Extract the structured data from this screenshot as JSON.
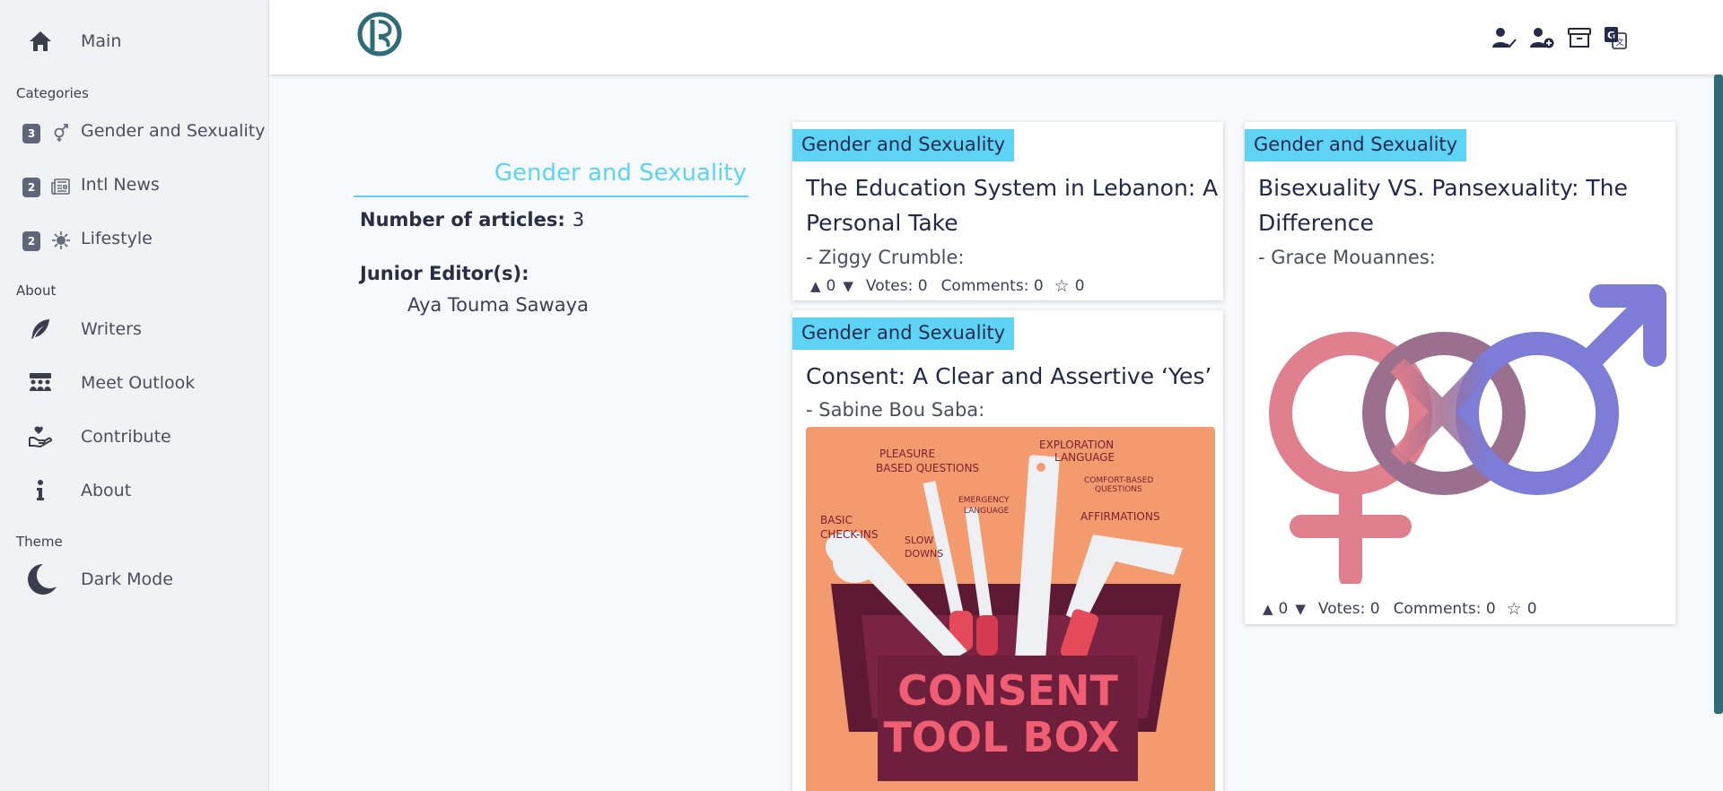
{
  "sidebar": {
    "main_label": "Main",
    "categories_heading": "Categories",
    "categories": [
      {
        "count": "3",
        "label": "Gender and Sexuality",
        "icon": "gender-icon"
      },
      {
        "count": "2",
        "label": "Intl News",
        "icon": "newspaper-icon"
      },
      {
        "count": "2",
        "label": "Lifestyle",
        "icon": "virus-icon"
      }
    ],
    "about_heading": "About",
    "about_items": [
      {
        "label": "Writers",
        "icon": "feather-icon"
      },
      {
        "label": "Meet Outlook",
        "icon": "team-icon"
      },
      {
        "label": "Contribute",
        "icon": "hand-heart-icon"
      },
      {
        "label": "About",
        "icon": "info-icon"
      }
    ],
    "theme_heading": "Theme",
    "dark_mode_label": "Dark Mode"
  },
  "header": {
    "icons": [
      "user-check-icon",
      "user-plus-icon",
      "archive-icon",
      "translate-icon"
    ]
  },
  "category": {
    "title": "Gender and Sexuality",
    "num_articles_label": "Number of articles:",
    "num_articles_value": "3",
    "junior_editors_label": "Junior Editor(s):",
    "junior_editors": [
      "Aya Touma Sawaya"
    ]
  },
  "articles": [
    {
      "tag": "Gender and Sexuality",
      "title_line1": "The Education System in Lebanon: A",
      "title_line2": "Personal Take",
      "author": "- Ziggy Crumble:",
      "up": "0",
      "votes": "Votes: 0",
      "comments": "Comments: 0",
      "stars": "0"
    },
    {
      "tag": "Gender and Sexuality",
      "title_line1": "Consent: A Clear and Assertive ‘Yes’",
      "author": "- Sabine Bou Saba:",
      "image_text": {
        "pleasure": "PLEASURE",
        "based": "BASED QUESTIONS",
        "exploration": "EXPLORATION",
        "language": "LANGUAGE",
        "comfort": "COMFORT-BASED",
        "questions": "QUESTIONS",
        "emergency": "EMERGENCY",
        "emergency_lang": "LANGUAGE",
        "basic": "BASIC",
        "checkins": "CHECK-INS",
        "slow": "SLOW",
        "downs": "DOWNS",
        "affirmations": "AFFIRMATIONS",
        "consent": "CONSENT",
        "toolbox": "TOOL BOX"
      }
    },
    {
      "tag": "Gender and Sexuality",
      "title_line1": "Bisexuality VS. Pansexuality: The",
      "title_line2": "Difference",
      "author": "- Grace Mouannes:",
      "up": "0",
      "votes": "Votes: 0",
      "comments": "Comments: 0",
      "stars": "0"
    }
  ]
}
